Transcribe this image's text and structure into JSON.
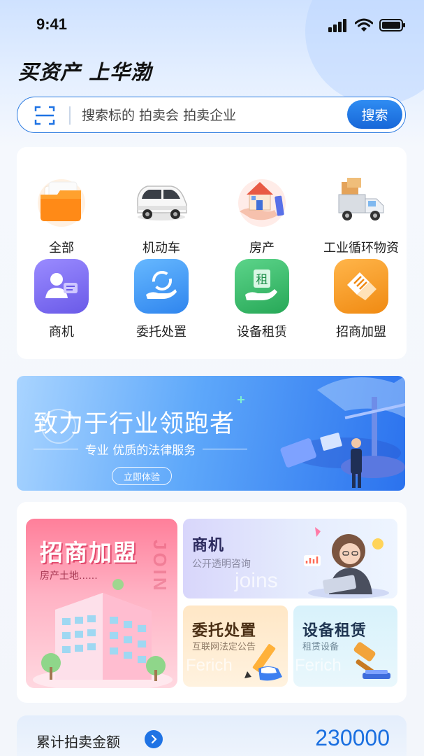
{
  "status_bar": {
    "time": "9:41"
  },
  "header": {
    "title": "买资产 上华渤"
  },
  "search": {
    "placeholder": "搜索标的 拍卖会 拍卖企业",
    "button_label": "搜索"
  },
  "categories": [
    {
      "label": "全部",
      "icon": "folder-icon"
    },
    {
      "label": "机动车",
      "icon": "car-icon"
    },
    {
      "label": "房产",
      "icon": "house-icon"
    },
    {
      "label": "工业循环物资",
      "icon": "truck-icon"
    }
  ],
  "services": [
    {
      "label": "商机",
      "icon": "business-user-icon",
      "color": "#7b6cf0"
    },
    {
      "label": "委托处置",
      "icon": "hand-refresh-icon",
      "color": "#3d9af2"
    },
    {
      "label": "设备租赁",
      "icon": "rent-hand-icon",
      "color": "#34b463",
      "glyph": "租"
    },
    {
      "label": "招商加盟",
      "icon": "handshake-icon",
      "color": "#f29a22"
    }
  ],
  "banner": {
    "title": "致力于行业领跑者",
    "subtitle": "专业 优质的法律服务",
    "button_label": "立即体验"
  },
  "features": {
    "join": {
      "title": "招商加盟",
      "subtitle": "房产土地......",
      "vertical_text": "JOIN"
    },
    "business": {
      "title": "商机",
      "subtitle": "公开透明咨询",
      "ghost": "joins"
    },
    "entrust": {
      "title": "委托处置",
      "subtitle": "互联网法定公告",
      "ghost": "Ferich"
    },
    "lease": {
      "title": "设备租赁",
      "subtitle": "租赁设备",
      "ghost": "Ferich"
    }
  },
  "stats": {
    "label": "累计拍卖金额",
    "value": "230000"
  },
  "colors": {
    "brand_blue": "#1f73e4",
    "accent_pink": "#ff7f9a"
  }
}
